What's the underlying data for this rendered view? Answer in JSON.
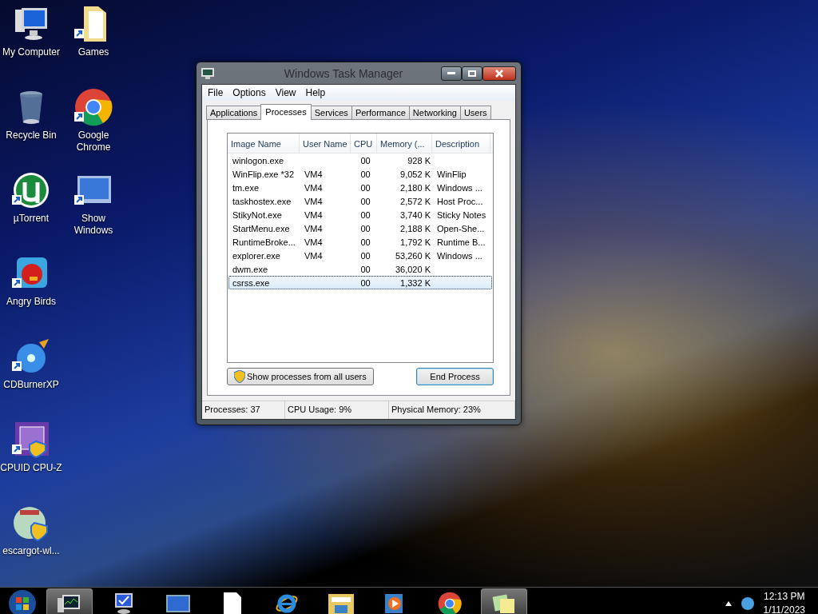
{
  "desktop_icons": [
    {
      "label": "My Computer"
    },
    {
      "label": "Recycle Bin"
    },
    {
      "label": "µTorrent"
    },
    {
      "label": "Angry Birds"
    },
    {
      "label": "CDBurnerXP"
    },
    {
      "label": "CPUID CPU-Z"
    },
    {
      "label": "escargot-wl..."
    },
    {
      "label": "Games"
    },
    {
      "label": "Google Chrome"
    },
    {
      "label": "Show Windows"
    }
  ],
  "window": {
    "title": "Windows Task Manager",
    "menu": [
      "File",
      "Options",
      "View",
      "Help"
    ],
    "tabs": [
      {
        "label": "Applications",
        "selected": false
      },
      {
        "label": "Processes",
        "selected": true
      },
      {
        "label": "Services",
        "selected": false
      },
      {
        "label": "Performance",
        "selected": false
      },
      {
        "label": "Networking",
        "selected": false
      },
      {
        "label": "Users",
        "selected": false
      }
    ],
    "table": {
      "columns": [
        "Image Name",
        "User Name",
        "CPU",
        "Memory (...",
        "Description"
      ],
      "rows": [
        {
          "cells": [
            "winlogon.exe",
            "",
            "00",
            "928 K",
            ""
          ],
          "selected": false
        },
        {
          "cells": [
            "WinFlip.exe *32",
            "VM4",
            "00",
            "9,052 K",
            "WinFlip"
          ],
          "selected": false
        },
        {
          "cells": [
            "tm.exe",
            "VM4",
            "00",
            "2,180 K",
            "Windows ..."
          ],
          "selected": false
        },
        {
          "cells": [
            "taskhostex.exe",
            "VM4",
            "00",
            "2,572 K",
            "Host Proc..."
          ],
          "selected": false
        },
        {
          "cells": [
            "StikyNot.exe",
            "VM4",
            "00",
            "3,740 K",
            "Sticky Notes"
          ],
          "selected": false
        },
        {
          "cells": [
            "StartMenu.exe",
            "VM4",
            "00",
            "2,188 K",
            "Open-She..."
          ],
          "selected": false
        },
        {
          "cells": [
            "RuntimeBroke...",
            "VM4",
            "00",
            "1,792 K",
            "Runtime B..."
          ],
          "selected": false
        },
        {
          "cells": [
            "explorer.exe",
            "VM4",
            "00",
            "53,260 K",
            "Windows ..."
          ],
          "selected": false
        },
        {
          "cells": [
            "dwm.exe",
            "",
            "00",
            "36,020 K",
            ""
          ],
          "selected": false
        },
        {
          "cells": [
            "csrss.exe",
            "",
            "00",
            "1,332 K",
            ""
          ],
          "selected": true
        }
      ]
    },
    "buttons": [
      "Show processes from all users",
      "End Process"
    ],
    "status_bar": [
      "Processes: 37",
      "CPU Usage: 9%",
      "Physical Memory: 23%"
    ]
  },
  "taskbar": {
    "items": [
      {
        "active": true
      },
      {
        "active": false
      },
      {
        "active": false
      },
      {
        "active": false
      },
      {
        "active": false
      },
      {
        "active": false
      },
      {
        "active": false
      },
      {
        "active": false
      },
      {
        "active": true
      }
    ],
    "time": "12:13 PM",
    "date": "1/11/2023"
  }
}
